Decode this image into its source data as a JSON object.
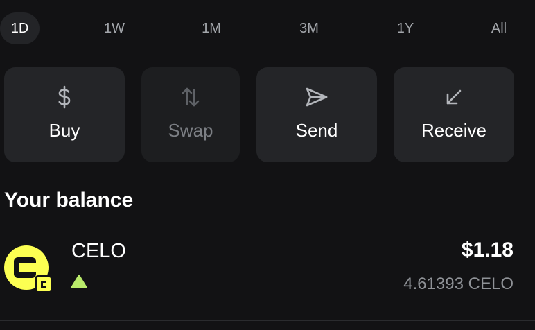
{
  "range_tabs": [
    {
      "label": "1D",
      "active": true
    },
    {
      "label": "1W",
      "active": false
    },
    {
      "label": "1M",
      "active": false
    },
    {
      "label": "3M",
      "active": false
    },
    {
      "label": "1Y",
      "active": false
    },
    {
      "label": "All",
      "active": false
    }
  ],
  "actions": [
    {
      "label": "Buy",
      "icon": "dollar-icon",
      "enabled": true
    },
    {
      "label": "Swap",
      "icon": "swap-arrows-icon",
      "enabled": false
    },
    {
      "label": "Send",
      "icon": "send-icon",
      "enabled": true
    },
    {
      "label": "Receive",
      "icon": "receive-arrow-icon",
      "enabled": true
    }
  ],
  "balance_section": {
    "title": "Your balance"
  },
  "assets": [
    {
      "name": "CELO",
      "value": "$1.18",
      "amount": "4.61393 CELO",
      "trend": "up",
      "logo_color": "#fcff52",
      "trend_color": "#b9ea6a"
    }
  ],
  "colors": {
    "background": "#121214",
    "button_bg": "#242528",
    "tab_active_bg": "#232427",
    "muted_text": "#8f9297"
  }
}
